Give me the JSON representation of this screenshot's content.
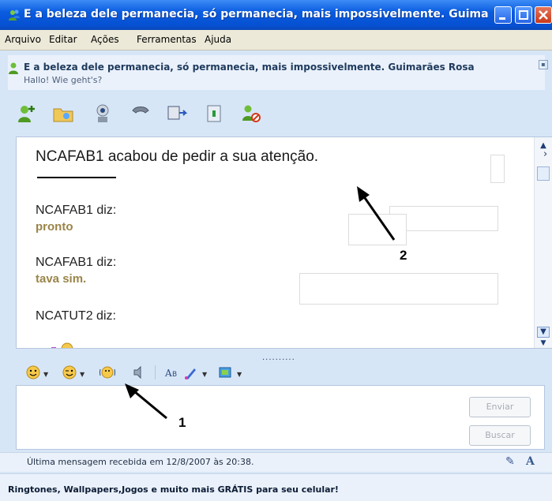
{
  "window": {
    "title": "E a beleza dele permanecia, só permanecia, mais impossivelmente. Guimarã..."
  },
  "menu": [
    "Arquivo",
    "Editar",
    "Ações",
    "Ferramentas",
    "Ajuda"
  ],
  "contact": {
    "name": "E a beleza dele permanecia, só permanecia, mais impossivelmente. Guimarães Rosa",
    "status": "Hallo! Wie geht's?"
  },
  "toolbar": [
    "add-contact-icon",
    "share-folder-icon",
    "webcam-icon",
    "phone-icon",
    "activities-icon",
    "games-icon",
    "block-icon"
  ],
  "conversation": {
    "notice": "NCAFAB1 acabou de pedir a sua atenção.",
    "messages": [
      {
        "sender": "NCAFAB1 diz:",
        "text": "pronto"
      },
      {
        "sender": "NCAFAB1 diz:",
        "text": "tava sim."
      },
      {
        "sender": "NCATUT2 diz:",
        "text": ""
      }
    ]
  },
  "splitter": "..........",
  "buttons": {
    "send": "Enviar",
    "search": "Buscar"
  },
  "status": "Última mensagem recebida em 12/8/2007 às 20:38.",
  "ad": "Ringtones, Wallpapers,Jogos e muito mais GRÁTIS para seu celular!",
  "annotations": [
    "1",
    "2"
  ],
  "colors": {
    "titlebar": "#0a5ce0",
    "message_text": "#9a8448",
    "panel": "#eaf1fb"
  }
}
